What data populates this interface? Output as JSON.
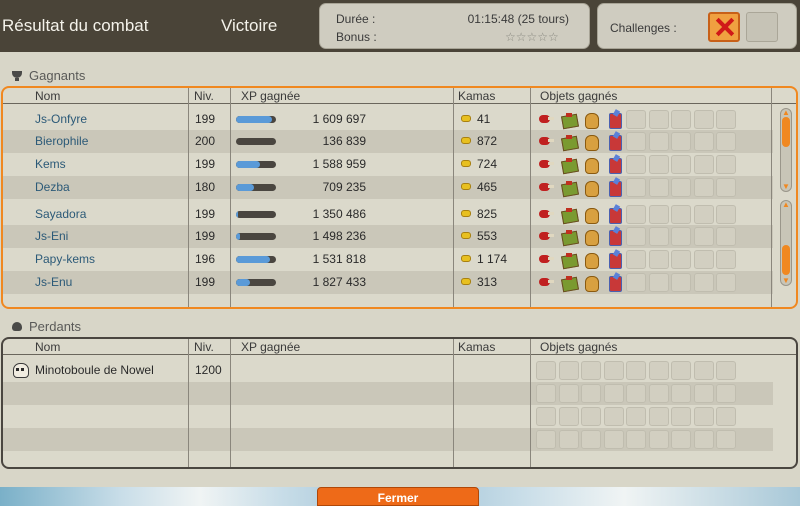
{
  "header": {
    "title": "Résultat du combat",
    "outcome": "Victoire",
    "duration_label": "Durée :",
    "duration_value": "01:15:48 (25 tours)",
    "bonus_label": "Bonus :",
    "bonus_stars": "☆☆☆☆☆",
    "challenges_label": "Challenges :"
  },
  "columns": {
    "name": "Nom",
    "level": "Niv.",
    "xp": "XP gagnée",
    "kamas": "Kamas",
    "items": "Objets gagnés"
  },
  "winners": {
    "title": "Gagnants",
    "rows": [
      {
        "name": "Js-Onfyre",
        "level": "199",
        "xp": "1 609 697",
        "xp_fill": 0.9,
        "kamas": "41"
      },
      {
        "name": "Bierophile",
        "level": "200",
        "xp": "136 839",
        "xp_fill": 0.0,
        "kamas": "872"
      },
      {
        "name": "Kems",
        "level": "199",
        "xp": "1 588 959",
        "xp_fill": 0.6,
        "kamas": "724"
      },
      {
        "name": "Dezba",
        "level": "180",
        "xp": "709 235",
        "xp_fill": 0.45,
        "kamas": "465"
      },
      {
        "name": "Sayadora",
        "level": "199",
        "xp": "1 350 486",
        "xp_fill": 0.05,
        "kamas": "825"
      },
      {
        "name": "Js-Eni",
        "level": "199",
        "xp": "1 498 236",
        "xp_fill": 0.1,
        "kamas": "553"
      },
      {
        "name": "Papy-kems",
        "level": "196",
        "xp": "1 531 818",
        "xp_fill": 0.85,
        "kamas": "1 174"
      },
      {
        "name": "Js-Enu",
        "level": "199",
        "xp": "1 827 433",
        "xp_fill": 0.35,
        "kamas": "313"
      }
    ]
  },
  "losers": {
    "title": "Perdants",
    "rows": [
      {
        "name": "Minotoboule de Nowel",
        "level": "1200"
      }
    ]
  },
  "item_icons": [
    "red-bird-icon",
    "gift-box-icon",
    "sack-icon",
    "potion-jar-icon"
  ],
  "close_button": "Fermer",
  "colors": {
    "accent": "#f08820",
    "header_bg": "#4a4438",
    "xp_bar": "#5a9ad8",
    "name_text": "#2c5a78"
  }
}
